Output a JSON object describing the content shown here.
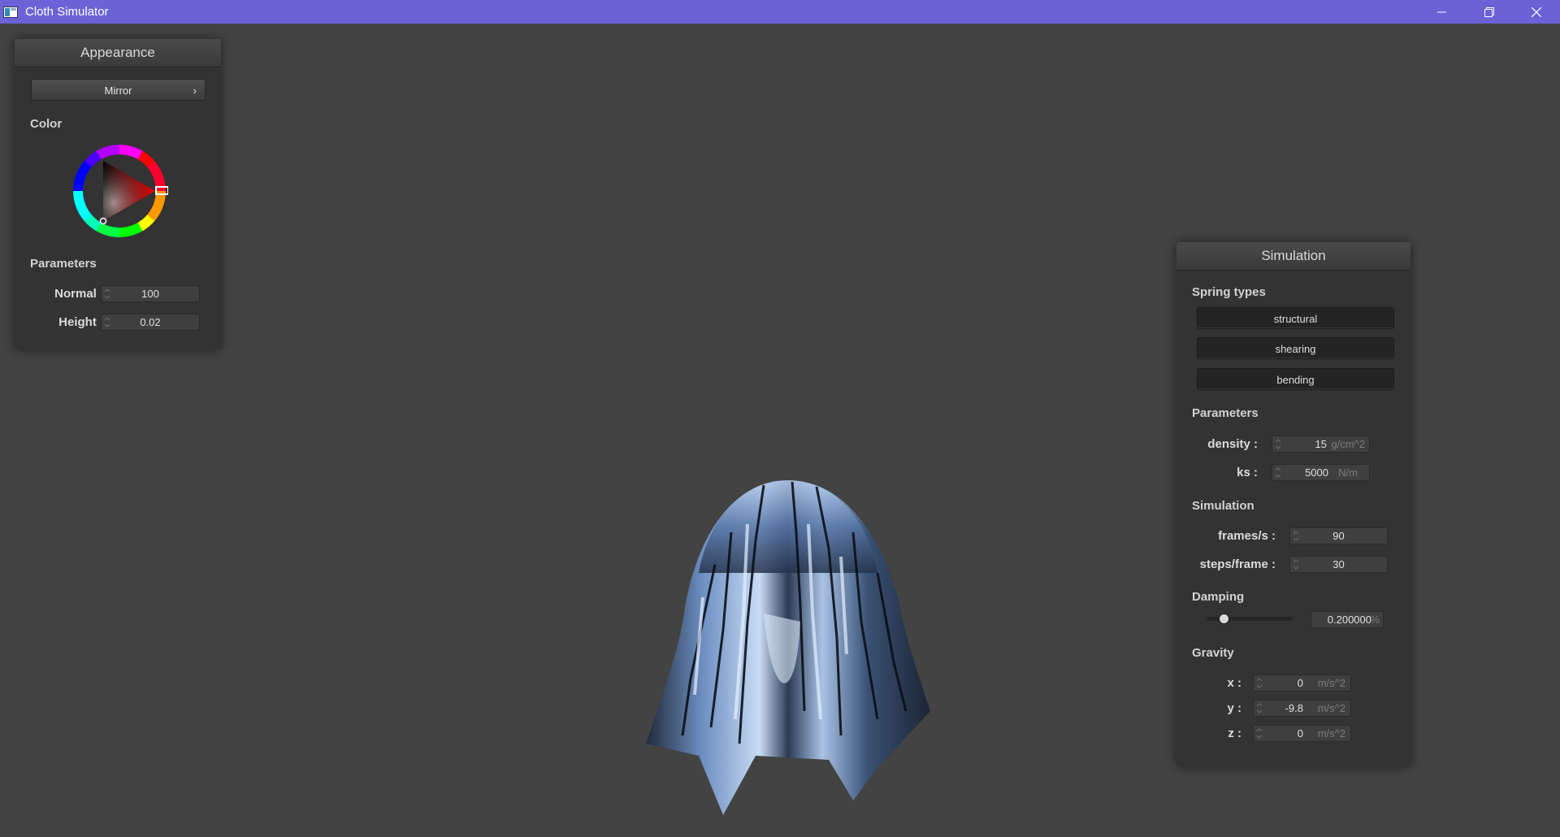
{
  "window": {
    "title": "Cloth Simulator"
  },
  "appearance": {
    "title": "Appearance",
    "material": "Mirror",
    "color_label": "Color",
    "parameters_label": "Parameters",
    "normal_label": "Normal :",
    "normal_value": "100",
    "height_label": "Height :",
    "height_value": "0.02",
    "selected_color": "#ff0000"
  },
  "simulation_panel": {
    "title": "Simulation",
    "spring_types_label": "Spring types",
    "spring_buttons": [
      "structural",
      "shearing",
      "bending"
    ],
    "parameters_label": "Parameters",
    "density_label": "density :",
    "density_value": "15",
    "density_unit": "g/cm^2",
    "ks_label": "ks :",
    "ks_value": "5000",
    "ks_unit": "N/m",
    "simulation_label": "Simulation",
    "fps_label": "frames/s :",
    "fps_value": "90",
    "steps_label": "steps/frame :",
    "steps_value": "30",
    "damping_label": "Damping",
    "damping_value": "0.200000",
    "damping_unit": "%",
    "damping_fraction": 0.2,
    "gravity_label": "Gravity",
    "gx_label": "x :",
    "gx_value": "0",
    "gy_label": "y :",
    "gy_value": "-9.8",
    "gz_label": "z :",
    "gz_value": "0",
    "gravity_unit": "m/s^2"
  },
  "colors": {
    "titlebar": "#6a63d6",
    "background": "#434343",
    "panel": "#333333"
  }
}
